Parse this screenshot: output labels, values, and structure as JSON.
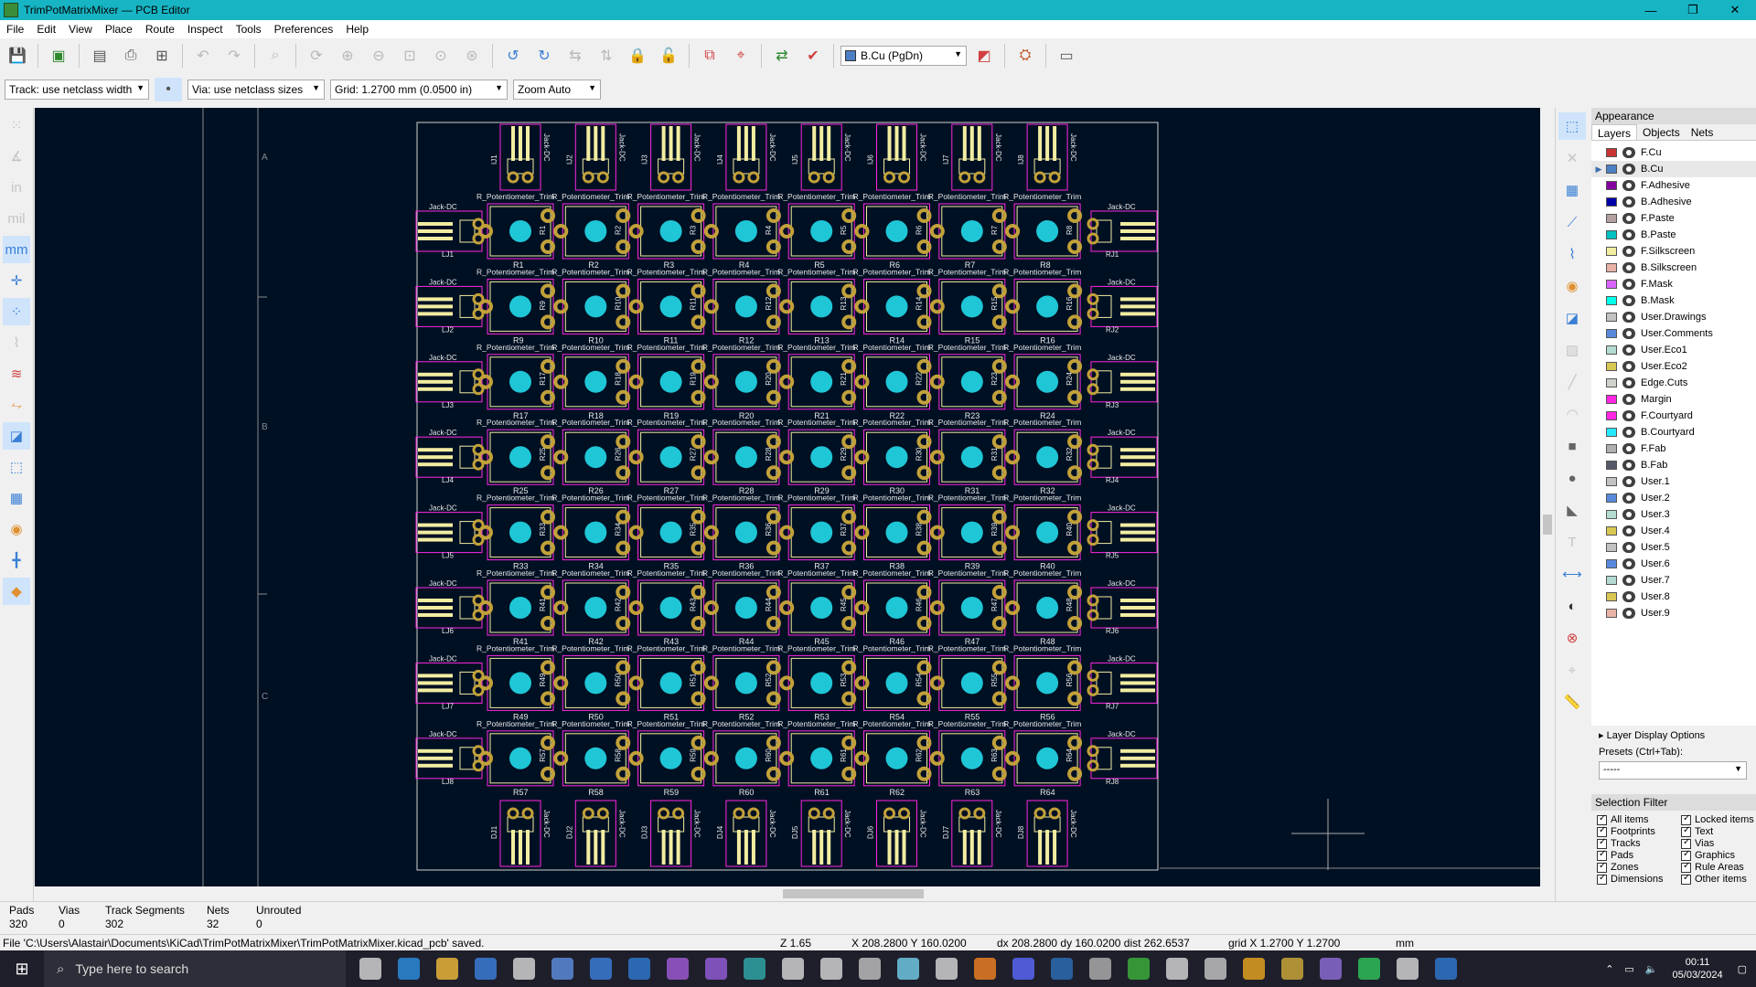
{
  "window": {
    "title": "TrimPotMatrixMixer — PCB Editor"
  },
  "menu": [
    "File",
    "Edit",
    "View",
    "Place",
    "Route",
    "Inspect",
    "Tools",
    "Preferences",
    "Help"
  ],
  "toolbar": {
    "track_width": "Track: use netclass width",
    "via_size": "Via: use netclass sizes",
    "grid": "Grid: 1.2700 mm (0.0500 in)",
    "zoom": "Zoom Auto",
    "active_layer": "B.Cu (PgDn)",
    "active_layer_color": "#4d7fc4"
  },
  "board": {
    "sheet_zones": [
      "A",
      "B",
      "C"
    ],
    "pot_footprint_label": "R_Potentiometer_Trim",
    "jack_label": "Jack-DC",
    "colors": {
      "background": "#001023",
      "courtyard": "#ff26e2",
      "pad": "#c2a13a",
      "copper_center": "#1fc6d6",
      "silkscreen": "#f2eda1",
      "edge": "#d0d2cd",
      "text": "#e8e8e8"
    },
    "pot_refs": [
      "R1",
      "R2",
      "R3",
      "R4",
      "R5",
      "R6",
      "R7",
      "R8",
      "R9",
      "R10",
      "R11",
      "R12",
      "R13",
      "R14",
      "R15",
      "R16",
      "R17",
      "R18",
      "R19",
      "R20",
      "R21",
      "R22",
      "R23",
      "R24",
      "R25",
      "R26",
      "R27",
      "R28",
      "R29",
      "R30",
      "R31",
      "R32",
      "R33",
      "R34",
      "R35",
      "R36",
      "R37",
      "R38",
      "R39",
      "R40",
      "R41",
      "R42",
      "R43",
      "R44",
      "R45",
      "R46",
      "R47",
      "R48",
      "R49",
      "R50",
      "R51",
      "R52",
      "R53",
      "R54",
      "R55",
      "R56",
      "R57",
      "R58",
      "R59",
      "R60",
      "R61",
      "R62",
      "R63",
      "R64"
    ],
    "top_jacks": [
      "IJ1",
      "IJ2",
      "IJ3",
      "IJ4",
      "IJ5",
      "IJ6",
      "IJ7",
      "IJ8"
    ],
    "left_jacks": [
      "LJ1",
      "LJ2",
      "LJ3",
      "LJ4",
      "LJ5",
      "LJ6",
      "LJ7",
      "LJ8"
    ],
    "right_jacks": [
      "RJ1",
      "RJ2",
      "RJ3",
      "RJ4",
      "RJ5",
      "RJ6",
      "RJ7",
      "RJ8"
    ],
    "bottom_jacks": [
      "DJ1",
      "DJ2",
      "DJ3",
      "DJ4",
      "DJ5",
      "DJ6",
      "DJ7",
      "DJ8"
    ]
  },
  "appearance": {
    "title": "Appearance",
    "tabs": [
      "Layers",
      "Objects",
      "Nets"
    ],
    "layers": [
      {
        "name": "F.Cu",
        "color": "#c83434"
      },
      {
        "name": "B.Cu",
        "color": "#4d7fc4"
      },
      {
        "name": "F.Adhesive",
        "color": "#84009e"
      },
      {
        "name": "B.Adhesive",
        "color": "#0000a8"
      },
      {
        "name": "F.Paste",
        "color": "#b4a0a0"
      },
      {
        "name": "B.Paste",
        "color": "#00c2c2"
      },
      {
        "name": "F.Silkscreen",
        "color": "#f2eda1"
      },
      {
        "name": "B.Silkscreen",
        "color": "#e8b2a7"
      },
      {
        "name": "F.Mask",
        "color": "#d864ff"
      },
      {
        "name": "B.Mask",
        "color": "#02ffee"
      },
      {
        "name": "User.Drawings",
        "color": "#c2c2c2"
      },
      {
        "name": "User.Comments",
        "color": "#5989db"
      },
      {
        "name": "User.Eco1",
        "color": "#b4dbd2"
      },
      {
        "name": "User.Eco2",
        "color": "#d8c852"
      },
      {
        "name": "Edge.Cuts",
        "color": "#d0d2cd"
      },
      {
        "name": "Margin",
        "color": "#ff26e2"
      },
      {
        "name": "F.Courtyard",
        "color": "#ff26e2"
      },
      {
        "name": "B.Courtyard",
        "color": "#26e9ff"
      },
      {
        "name": "F.Fab",
        "color": "#afafaf"
      },
      {
        "name": "B.Fab",
        "color": "#58586b"
      },
      {
        "name": "User.1",
        "color": "#c2c2c2"
      },
      {
        "name": "User.2",
        "color": "#5989db"
      },
      {
        "name": "User.3",
        "color": "#b4dbd2"
      },
      {
        "name": "User.4",
        "color": "#d8c852"
      },
      {
        "name": "User.5",
        "color": "#c2c2c2"
      },
      {
        "name": "User.6",
        "color": "#5989db"
      },
      {
        "name": "User.7",
        "color": "#b4dbd2"
      },
      {
        "name": "User.8",
        "color": "#d8c852"
      },
      {
        "name": "User.9",
        "color": "#e8b2a7"
      }
    ],
    "layer_display_options": "Layer Display Options",
    "presets_label": "Presets (Ctrl+Tab):",
    "presets_value": "-----",
    "selection_filter_title": "Selection Filter",
    "selection_filter": [
      "All items",
      "Locked items",
      "Footprints",
      "Text",
      "Tracks",
      "Vias",
      "Pads",
      "Graphics",
      "Zones",
      "Rule Areas",
      "Dimensions",
      "Other items"
    ]
  },
  "messages": {
    "pads_label": "Pads",
    "pads": "320",
    "vias_label": "Vias",
    "vias": "0",
    "tracks_label": "Track Segments",
    "tracks": "302",
    "nets_label": "Nets",
    "nets": "32",
    "unrouted_label": "Unrouted",
    "unrouted": "0"
  },
  "status": {
    "file": "File 'C:\\Users\\Alastair\\Documents\\KiCad\\TrimPotMatrixMixer\\TrimPotMatrixMixer.kicad_pcb' saved.",
    "zoom": "Z 1.65",
    "xy": "X 208.2800  Y 160.0200",
    "delta": "dx 208.2800  dy 160.0200  dist 262.6537",
    "grid": "grid X 1.2700  Y 1.2700",
    "units": "mm"
  },
  "taskbar": {
    "search_placeholder": "Type here to search",
    "time": "00:11",
    "date": "05/03/2024",
    "icon_colors": [
      "#d0d0d0",
      "#2a8ad8",
      "#e9b43a",
      "#3a7bd5",
      "#d0d0d0",
      "#5a8ad8",
      "#3a7bd5",
      "#2e75c9",
      "#9b59d0",
      "#8e5ad0",
      "#2fa3a3",
      "#d0d0d0",
      "#d0d0d0",
      "#bbbbbb",
      "#6ec6e0",
      "#d0d0d0",
      "#e67e22",
      "#5865f2",
      "#2a6bb0",
      "#aaaaaa",
      "#3aaa3a",
      "#d0d0d0",
      "#c0c0c0",
      "#e0a020",
      "#c8a63a",
      "#8a6ad0",
      "#2ebd59",
      "#d0d0d0",
      "#2f75c9"
    ]
  }
}
